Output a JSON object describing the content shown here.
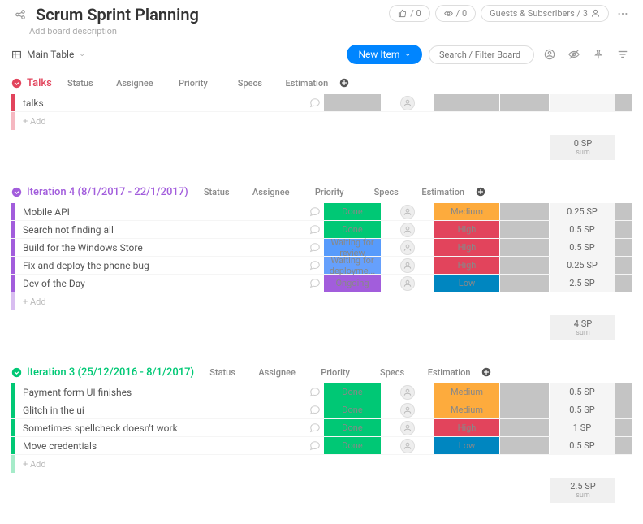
{
  "header": {
    "title": "Scrum Sprint Planning",
    "subtitle": "Add board description",
    "share_count": "0",
    "favorites_count": "0",
    "guests_label": "Guests & Subscribers / 3"
  },
  "toolbar": {
    "view_label": "Main Table",
    "new_item_label": "New Item",
    "search_placeholder": "Search / Filter Board"
  },
  "columns": {
    "status": "Status",
    "assignee": "Assignee",
    "priority": "Priority",
    "specs": "Specs",
    "estimation": "Estimation"
  },
  "add_row_label": "+ Add",
  "sum_sub": "sum",
  "groups": [
    {
      "id": "talks",
      "title": "Talks",
      "color": "red",
      "rows": [
        {
          "name": "talks",
          "status": "",
          "status_class": "blank",
          "priority": "",
          "priority_class": "blank",
          "est": ""
        }
      ],
      "sum": "0 SP"
    },
    {
      "id": "iter4",
      "title": "Iteration 4 (8/1/2017 - 22/1/2017)",
      "color": "purple",
      "rows": [
        {
          "name": "Mobile API",
          "status": "Done",
          "status_class": "st-done",
          "priority": "Medium",
          "priority_class": "pr-med",
          "est": "0.25 SP"
        },
        {
          "name": "Search not finding all",
          "status": "Done",
          "status_class": "st-done",
          "priority": "High",
          "priority_class": "pr-high",
          "est": "0.5 SP"
        },
        {
          "name": "Build for the Windows Store",
          "status": "Waiting for review",
          "status_class": "st-waitrev",
          "priority": "High",
          "priority_class": "pr-high",
          "est": "0.5 SP"
        },
        {
          "name": "Fix and deploy the phone bug",
          "status": "Waiting for deployme...",
          "status_class": "st-waitdep",
          "priority": "High",
          "priority_class": "pr-high",
          "est": "0.25 SP"
        },
        {
          "name": "Dev of the Day",
          "status": "Ongoing",
          "status_class": "st-ongoing",
          "priority": "Low",
          "priority_class": "pr-low",
          "est": "2.5 SP"
        }
      ],
      "sum": "4 SP"
    },
    {
      "id": "iter3",
      "title": "Iteration 3 (25/12/2016 - 8/1/2017)",
      "color": "green",
      "rows": [
        {
          "name": "Payment form UI finishes",
          "status": "Done",
          "status_class": "st-done",
          "priority": "Medium",
          "priority_class": "pr-med",
          "est": "0.5 SP"
        },
        {
          "name": "Glitch in the ui",
          "status": "Done",
          "status_class": "st-done",
          "priority": "Medium",
          "priority_class": "pr-med",
          "est": "0.5 SP"
        },
        {
          "name": "Sometimes spellcheck doesn't work",
          "status": "Done",
          "status_class": "st-done",
          "priority": "High",
          "priority_class": "pr-high",
          "est": "1 SP"
        },
        {
          "name": "Move credentials",
          "status": "Done",
          "status_class": "st-done",
          "priority": "Low",
          "priority_class": "pr-low",
          "est": "0.5 SP"
        }
      ],
      "sum": "2.5 SP"
    }
  ]
}
